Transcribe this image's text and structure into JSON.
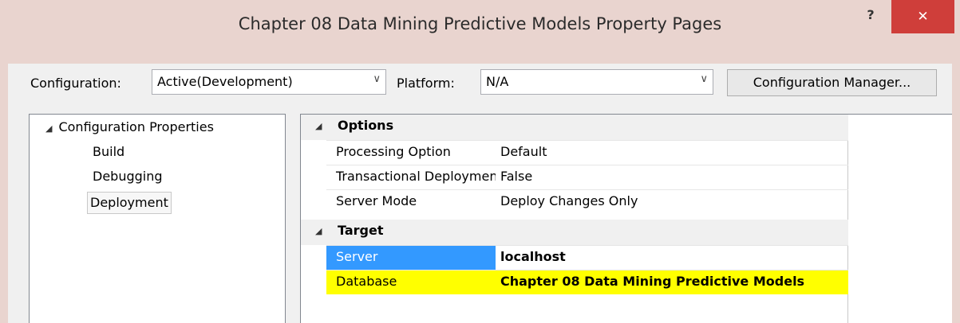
{
  "window": {
    "title": "Chapter 08 Data Mining Predictive Models Property Pages",
    "help_label": "?",
    "close_label": "✕"
  },
  "toolbar": {
    "configuration_label": "Configuration:",
    "configuration_value": "Active(Development)",
    "platform_label": "Platform:",
    "platform_value": "N/A",
    "config_manager_label": "Configuration Manager...",
    "dropdown_glyph": "∨"
  },
  "tree": {
    "expand_glyph": "◢",
    "root_label": "Configuration Properties",
    "children": [
      {
        "label": "Build"
      },
      {
        "label": "Debugging"
      },
      {
        "label": "Deployment"
      }
    ]
  },
  "grid": {
    "expand_glyph": "◢",
    "categories": [
      {
        "name": "Options",
        "rows": [
          {
            "name": "Processing Option",
            "value": "Default"
          },
          {
            "name": "Transactional Deployment",
            "value": "False"
          },
          {
            "name": "Server Mode",
            "value": "Deploy Changes Only"
          }
        ]
      },
      {
        "name": "Target",
        "rows": [
          {
            "name": "Server",
            "value": "localhost"
          },
          {
            "name": "Database",
            "value": "Chapter 08 Data Mining Predictive Models"
          }
        ]
      }
    ]
  },
  "colors": {
    "selection": "#3399ff",
    "highlight": "#ffff00",
    "close_button": "#cf3e3a",
    "title_bar": "#e9d4cf"
  }
}
